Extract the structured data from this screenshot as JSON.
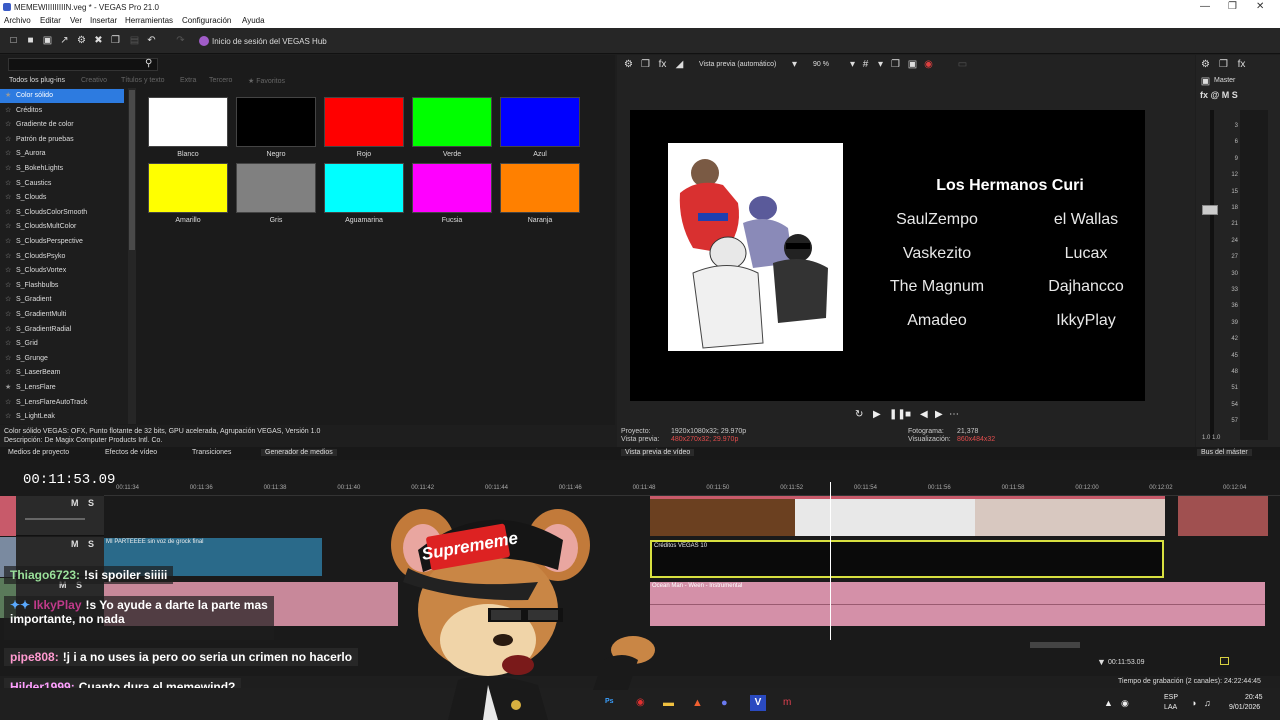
{
  "window": {
    "title": "MEMEWIIIIIIIIIN.veg * - VEGAS Pro 21.0"
  },
  "menu": [
    "Archivo",
    "Editar",
    "Ver",
    "Insertar",
    "Herramientas",
    "Configuración",
    "Ayuda"
  ],
  "toolbar": {
    "hub_label": "Inicio de sesión del VEGAS Hub"
  },
  "plugins": {
    "tabs": [
      "Todos los plug-ins",
      "Creativo",
      "Títulos y texto",
      "Extra",
      "Tercero",
      "Favoritos"
    ],
    "list": [
      "Color sólido",
      "Créditos",
      "Gradiente de color",
      "Patrón de pruebas",
      "S_Aurora",
      "S_BokehLights",
      "S_Caustics",
      "S_Clouds",
      "S_CloudsColorSmooth",
      "S_CloudsMultColor",
      "S_CloudsPerspective",
      "S_CloudsPsyko",
      "S_CloudsVortex",
      "S_Flashbulbs",
      "S_Gradient",
      "S_GradientMulti",
      "S_GradientRadial",
      "S_Grid",
      "S_Grunge",
      "S_LaserBeam",
      "S_LensFlare",
      "S_LensFlareAutoTrack",
      "S_LightLeak"
    ],
    "selected_index": 0,
    "swatches": [
      {
        "label": "Blanco",
        "color": "#ffffff"
      },
      {
        "label": "Negro",
        "color": "#000000"
      },
      {
        "label": "Rojo",
        "color": "#ff0000"
      },
      {
        "label": "Verde",
        "color": "#00ff00"
      },
      {
        "label": "Azul",
        "color": "#0000ff"
      },
      {
        "label": "Amarillo",
        "color": "#ffff00"
      },
      {
        "label": "Gris",
        "color": "#808080"
      },
      {
        "label": "Aguamarina",
        "color": "#00ffff"
      },
      {
        "label": "Fucsia",
        "color": "#ff00ff"
      },
      {
        "label": "Naranja",
        "color": "#ff8000"
      }
    ],
    "desc_line1": "Color sólido VEGAS: OFX, Punto flotante de 32 bits, GPU acelerada, Agrupación VEGAS, Versión 1.0",
    "desc_line2": "Descripción: De Magix Computer Products Intl. Co."
  },
  "preview": {
    "mode": "Vista previa (automático)",
    "zoom": "90 %",
    "credits_title": "Los Hermanos Curi",
    "credits_left": [
      "SaulZempo",
      "Vaskezito",
      "The Magnum",
      "Amadeo"
    ],
    "credits_right": [
      "el Wallas",
      "Lucax",
      "Dajhancco",
      "IkkyPlay"
    ],
    "info": {
      "proyecto_label": "Proyecto:",
      "proyecto_value": "1920x1080x32; 29.970p",
      "vista_label": "Vista previa:",
      "vista_value": "480x270x32; 29.970p",
      "fotograma_label": "Fotograma:",
      "fotograma_value": "21,378",
      "visualizacion_label": "Visualización:",
      "visualizacion_value": "860x484x32"
    }
  },
  "master": {
    "label": "Master",
    "fx": "fx @ M S",
    "ticks": [
      "3",
      "6",
      "9",
      "12",
      "15",
      "18",
      "21",
      "24",
      "27",
      "30",
      "33",
      "36",
      "39",
      "42",
      "45",
      "48",
      "51",
      "54",
      "57"
    ],
    "bottom": "1.0   1.0"
  },
  "dock_tabs": [
    "Medios de proyecto",
    "Efectos de vídeo",
    "Transiciones",
    "Generador de medios",
    "Vista previa de vídeo",
    "Bus del máster"
  ],
  "timeline": {
    "time": "00:11:53.09",
    "ruler": [
      "00:11:34",
      "00:11:36",
      "00:11:38",
      "00:11:40",
      "00:11:42",
      "00:11:44",
      "00:11:46",
      "00:11:48",
      "00:11:50",
      "00:11:52",
      "00:11:54",
      "00:11:56",
      "00:11:58",
      "00:12:00",
      "00:12:02",
      "00:12:04"
    ],
    "clip_video2": "MI PARTEEEE sin voz de grock final",
    "clip_credits": "Créditos VEGAS 10",
    "clip_audio": "Ocean Man - Ween - Instrumental",
    "cursor_time": "00:11:53.09",
    "rec_time": "Tiempo de grabación (2 canales): 24:22:44:45"
  },
  "chat": [
    {
      "user": "Thiago6723:",
      "msg": "!si spoiler siiiii",
      "color": "#a0ffa0"
    },
    {
      "user": "IkkyPlay",
      "msg": "!s Yo ayude a darte la parte mas",
      "msg2": "importante, no nada",
      "color": "#c03a8a"
    },
    {
      "user": "pipe808:",
      "msg": "!j i a no uses ia pero oo seria un crimen no hacerlo",
      "color": "#ff9ad0"
    },
    {
      "user": "Hilder1999:",
      "msg": "Cuanto dura el memewind?",
      "color": "#ffa0ff"
    }
  ],
  "mascot_text": "Suprememe",
  "taskbar": {
    "lang": "ESP",
    "lang2": "LAA",
    "time": "20:45",
    "date": "9/01/2026"
  }
}
